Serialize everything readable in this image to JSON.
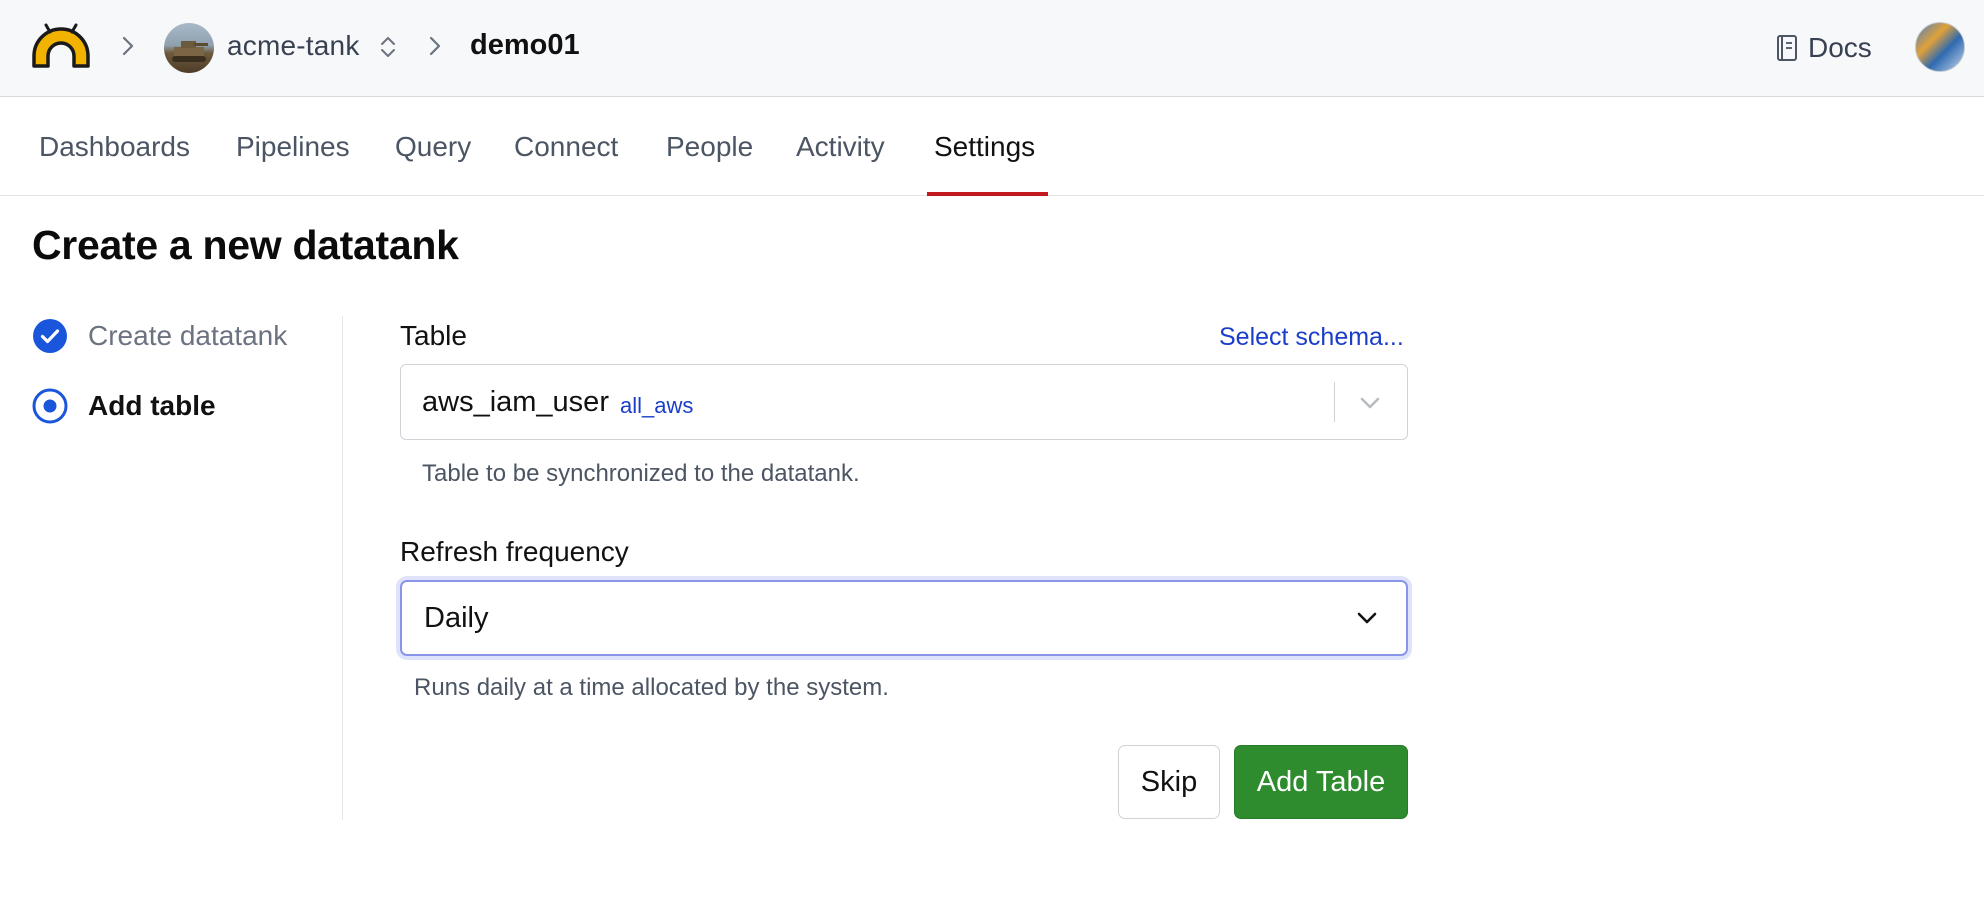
{
  "header": {
    "org_name": "acme-tank",
    "project_name": "demo01",
    "docs_label": "Docs"
  },
  "tabs": [
    {
      "label": "Dashboards",
      "active": false
    },
    {
      "label": "Pipelines",
      "active": false
    },
    {
      "label": "Query",
      "active": false
    },
    {
      "label": "Connect",
      "active": false
    },
    {
      "label": "People",
      "active": false
    },
    {
      "label": "Activity",
      "active": false
    },
    {
      "label": "Settings",
      "active": true
    }
  ],
  "page": {
    "title": "Create a new datatank"
  },
  "steps": [
    {
      "label": "Create datatank",
      "state": "done"
    },
    {
      "label": "Add table",
      "state": "current"
    }
  ],
  "form": {
    "table": {
      "label": "Table",
      "select_schema_link": "Select schema...",
      "value": "aws_iam_user",
      "schema": "all_aws",
      "help": "Table to be synchronized to the datatank."
    },
    "refresh": {
      "label": "Refresh frequency",
      "value": "Daily",
      "help": "Runs daily at a time allocated by the system."
    },
    "skip_label": "Skip",
    "add_label": "Add Table"
  },
  "colors": {
    "accent_blue": "#1a56db",
    "link_blue": "#1a3ec9",
    "tab_active_underline": "#c2191f",
    "primary_button": "#2e8b2e",
    "logo_yellow": "#f2b300"
  }
}
